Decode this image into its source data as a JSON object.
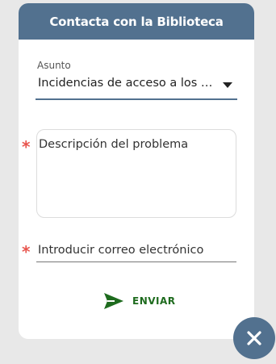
{
  "header": {
    "title": "Contacta con la Biblioteca"
  },
  "form": {
    "subject_label": "Asunto",
    "subject_value": "Incidencias de acceso a los recursos electrónicos",
    "required_marker": "*",
    "description_placeholder": "Descripción del problema",
    "email_placeholder": "Introducir correo electrónico",
    "send_label": "ENVIAR"
  },
  "icons": {
    "dropdown": "chevron-down-icon",
    "send": "send-icon",
    "close": "close-icon"
  },
  "colors": {
    "header_bg": "#52718f",
    "required": "#e8554e",
    "send": "#1e6b1e",
    "close_bg": "#52718f"
  }
}
